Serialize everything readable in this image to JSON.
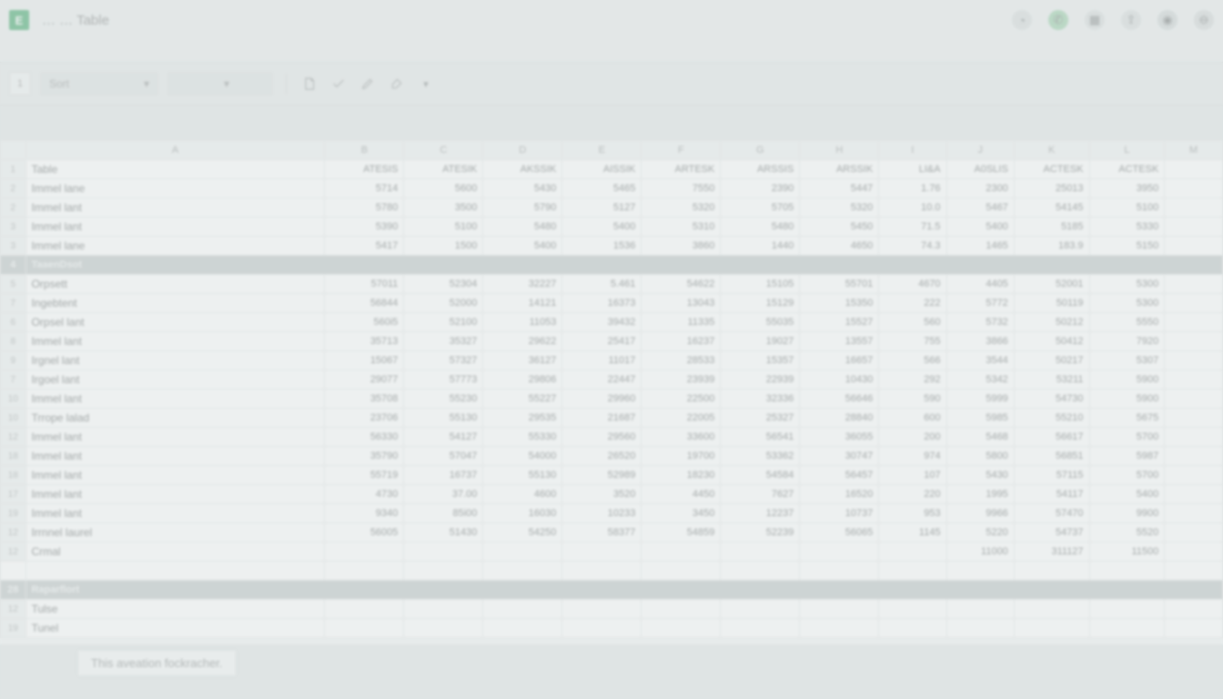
{
  "titlebar": {
    "logo": "E",
    "doc": "…   …   Table"
  },
  "menubar": {
    "items": [
      "",
      "",
      "",
      "",
      "",
      "",
      "",
      "",
      ""
    ],
    "right": [
      "",
      "",
      ""
    ]
  },
  "toolbar": {
    "row_ind": "1",
    "sort": "Sort",
    "caret": "▾"
  },
  "columns": [
    "",
    "A",
    "B",
    "C",
    "D",
    "E",
    "F",
    "G",
    "H",
    "I",
    "J",
    "K",
    "L",
    "M"
  ],
  "headers": [
    "Table",
    "ATESIS",
    "ATESIK",
    "AKSSIK",
    "AISSIK",
    "ARTESK",
    "ARSSIS",
    "ARSSIK",
    "LI&A",
    "A0SLIS",
    "ACTESK",
    "ACTESK"
  ],
  "rows": [
    {
      "n": "1",
      "a": "Table",
      "v": [
        "ATESIS",
        "ATESIK",
        "AKSSIK",
        "AISSIK",
        "ARTESK",
        "ARSSIS",
        "ARSSIK",
        "LI&A",
        "A0SLIS",
        "ACTESK",
        "ACTESK"
      ]
    },
    {
      "n": "2",
      "a": "Immel lane",
      "v": [
        "5714",
        "5600",
        "5430",
        "5465",
        "7550",
        "2390",
        "5447",
        "1.76",
        "2300",
        "25013",
        "3950"
      ]
    },
    {
      "n": "2",
      "a": "Immel lant",
      "v": [
        "5780",
        "3500",
        "5790",
        "5127",
        "5320",
        "5705",
        "5320",
        "10.0",
        "5467",
        "54145",
        "5100"
      ]
    },
    {
      "n": "3",
      "a": "Immel lant",
      "v": [
        "5390",
        "5100",
        "5480",
        "5400",
        "5310",
        "5480",
        "5450",
        "71.5",
        "5400",
        "5185",
        "5330"
      ]
    },
    {
      "n": "3",
      "a": "Immel lane",
      "v": [
        "5417",
        "1500",
        "5400",
        "1536",
        "3860",
        "1440",
        "4650",
        "74.3",
        "1465",
        "183.9",
        "5150"
      ]
    },
    {
      "section": "TaaenDsot",
      "n": "4"
    },
    {
      "n": "5",
      "a": "Orpsett",
      "v": [
        "57011",
        "52304",
        "32227",
        "5.461",
        "54622",
        "15105",
        "55701",
        "4670",
        "4405",
        "52001",
        "5300"
      ]
    },
    {
      "n": "7",
      "a": "Ingebtent",
      "v": [
        "56844",
        "52000",
        "14121",
        "16373",
        "13043",
        "15129",
        "15350",
        "222",
        "5772",
        "50119",
        "5300"
      ]
    },
    {
      "n": "6",
      "a": "Orpsel lant",
      "v": [
        "560i5",
        "52100",
        "11053",
        "39432",
        "11335",
        "55035",
        "15527",
        "560",
        "5732",
        "50212",
        "5550"
      ]
    },
    {
      "n": "8",
      "a": "Immel lant",
      "v": [
        "35713",
        "35327",
        "29622",
        "25417",
        "16237",
        "19027",
        "13557",
        "755",
        "3866",
        "50412",
        "7920"
      ]
    },
    {
      "n": "9",
      "a": "Irgnel lant",
      "v": [
        "15067",
        "57327",
        "36127",
        "11017",
        "28533",
        "15357",
        "16657",
        "566",
        "3544",
        "50217",
        "5307"
      ]
    },
    {
      "n": "7",
      "a": "Irgoel lant",
      "v": [
        "29077",
        "57773",
        "29806",
        "22447",
        "23939",
        "22939",
        "10430",
        "292",
        "5342",
        "53211",
        "5900"
      ]
    },
    {
      "n": "10",
      "a": "Immel lant",
      "v": [
        "35708",
        "55230",
        "55227",
        "29960",
        "22500",
        "32336",
        "56646",
        "590",
        "5999",
        "54730",
        "5900"
      ]
    },
    {
      "n": "10",
      "a": "Trrope lalad",
      "v": [
        "23706",
        "55130",
        "29535",
        "21687",
        "22005",
        "25327",
        "28840",
        "600",
        "5985",
        "55210",
        "5675"
      ]
    },
    {
      "n": "12",
      "a": "Immel lant",
      "v": [
        "56330",
        "54127",
        "55330",
        "29560",
        "33600",
        "56541",
        "36055",
        "200",
        "5468",
        "56617",
        "5700"
      ]
    },
    {
      "n": "18",
      "a": "Immel lant",
      "v": [
        "35790",
        "57047",
        "54000",
        "26520",
        "19700",
        "53362",
        "30747",
        "974",
        "5800",
        "56851",
        "5987"
      ]
    },
    {
      "n": "18",
      "a": "Immel lant",
      "v": [
        "55719",
        "16737",
        "55130",
        "52989",
        "18230",
        "54584",
        "56457",
        "107",
        "5430",
        "57115",
        "5700"
      ]
    },
    {
      "n": "17",
      "a": "Immel lant",
      "v": [
        "4730",
        "37.00",
        "4600",
        "3520",
        "4450",
        "7627",
        "16520",
        "220",
        "1995",
        "54117",
        "5400"
      ]
    },
    {
      "n": "19",
      "a": "Immel lant",
      "v": [
        "9340",
        "85i00",
        "16030",
        "10233",
        "3450",
        "12237",
        "10737",
        "953",
        "9966",
        "57470",
        "9900"
      ]
    },
    {
      "n": "12",
      "a": "Irrnnel laurel",
      "v": [
        "56005",
        "51430",
        "54250",
        "58377",
        "54859",
        "52239",
        "56065",
        "1145",
        "5220",
        "54737",
        "5520"
      ]
    },
    {
      "n": "12",
      "a": "Crmal",
      "v": [
        "",
        "",
        "",
        "",
        "",
        "",
        "",
        "",
        "11000",
        "311127",
        "11500"
      ]
    },
    {
      "blank": true,
      "n": ""
    },
    {
      "section": "Raparflort",
      "n": "28"
    },
    {
      "n": "12",
      "a": "Tulse",
      "v": [
        "",
        "",
        "",
        "",
        "",
        "",
        "",
        "",
        "",
        "",
        ""
      ]
    },
    {
      "n": "19",
      "a": "Tunel",
      "v": [
        "",
        "",
        "",
        "",
        "",
        "",
        "",
        "",
        "",
        "",
        ""
      ]
    }
  ],
  "status": "This aveation fockracher."
}
